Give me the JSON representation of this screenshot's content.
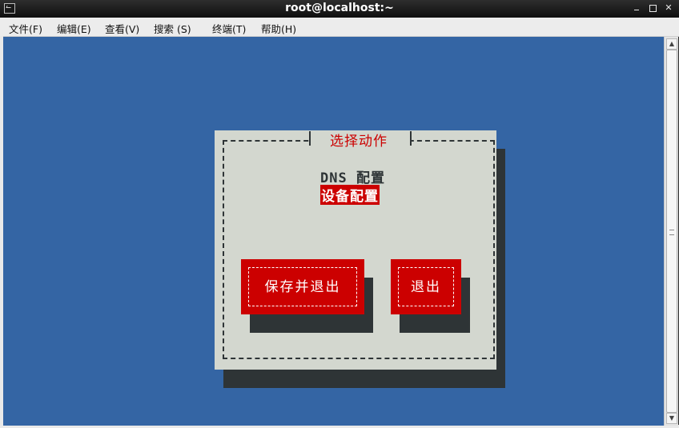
{
  "window": {
    "title": "root@localhost:~"
  },
  "menubar": {
    "items": [
      "文件(F)",
      "编辑(E)",
      "查看(V)",
      "搜索 (S)",
      "终端(T)",
      "帮助(H)"
    ]
  },
  "dialog": {
    "title": "选择动作",
    "list": [
      "DNS 配置",
      "设备配置"
    ],
    "selected_index": 1,
    "buttons": {
      "save_quit": "保存并退出",
      "quit": "退出"
    }
  },
  "colors": {
    "terminal_bg": "#3465a4",
    "dialog_bg": "#d3d7cf",
    "accent_red": "#cc0000",
    "shadow": "#2e3436"
  },
  "icons": {
    "window": "terminal-icon",
    "minimize": "minimize-icon",
    "maximize": "maximize-icon",
    "close": "close-icon",
    "scroll_up": "arrow-up-icon",
    "scroll_down": "arrow-down-icon"
  }
}
